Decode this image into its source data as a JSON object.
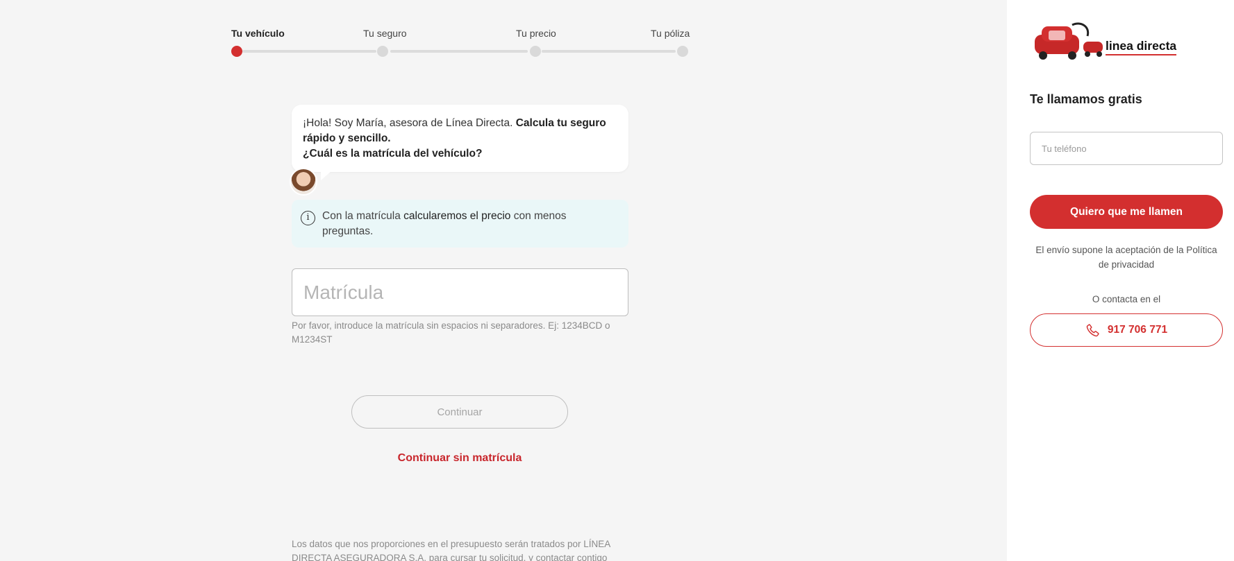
{
  "stepper": {
    "steps": [
      {
        "label": "Tu vehículo",
        "active": true
      },
      {
        "label": "Tu seguro",
        "active": false
      },
      {
        "label": "Tu precio",
        "active": false
      },
      {
        "label": "Tu póliza",
        "active": false
      }
    ]
  },
  "chat": {
    "intro": "¡Hola! Soy María, asesora de Línea Directa.",
    "bold1": "Calcula tu seguro rápido y sencillo.",
    "question": "¿Cuál es la matrícula del vehículo?"
  },
  "info": {
    "part1": "Con la matrícula",
    "bold": "calcularemos el precio",
    "part2": "con menos preguntas."
  },
  "plate": {
    "placeholder": "Matrícula",
    "value": "",
    "hint": "Por favor, introduce la matrícula sin espacios ni separadores. Ej: 1234BCD o M1234ST"
  },
  "actions": {
    "continue": "Continuar",
    "continue_without": "Continuar sin matrícula"
  },
  "legal": "Los datos que nos proporciones en el presupuesto serán tratados por LÍNEA DIRECTA ASEGURADORA S.A. para cursar tu solicitud, y contactar contigo",
  "sidebar": {
    "brand": "linea directa",
    "title": "Te llamamos gratis",
    "phone_placeholder": "Tu teléfono",
    "call_button": "Quiero que me llamen",
    "privacy": "El envío supone la aceptación de la Política de privacidad",
    "contact_label": "O contacta en el",
    "phone_number": "917 706 771"
  },
  "colors": {
    "brand_red": "#d32f2f",
    "info_bg": "#eaf7f8",
    "background": "#f5f5f5"
  }
}
